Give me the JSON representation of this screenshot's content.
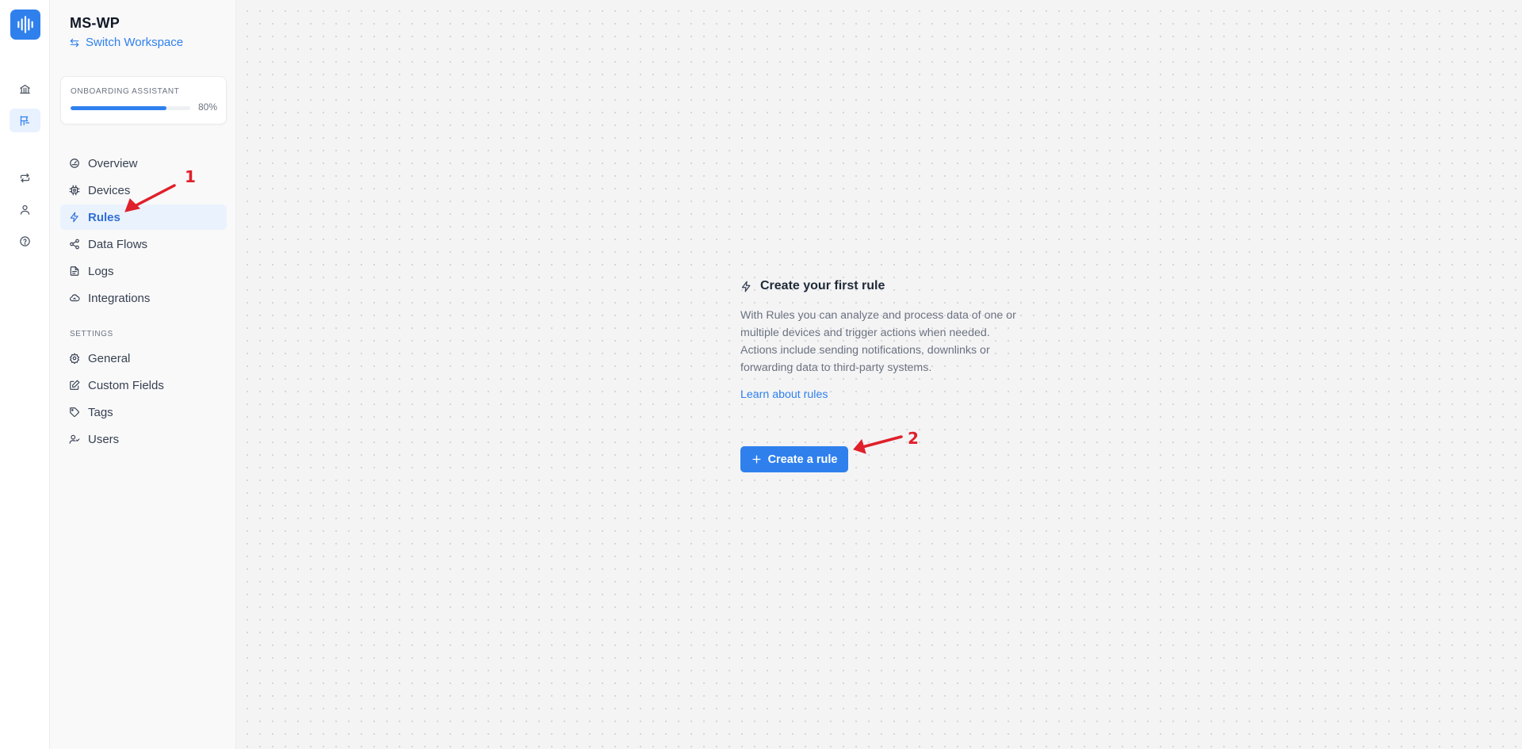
{
  "workspace": {
    "name": "MS-WP",
    "switch_label": "Switch Workspace"
  },
  "rail": {
    "items": [
      {
        "name": "bank-icon",
        "active": false
      },
      {
        "name": "flag-icon",
        "active": true
      },
      {
        "name": "repeat-icon",
        "active": false
      },
      {
        "name": "user-icon",
        "active": false
      },
      {
        "name": "help-icon",
        "active": false
      }
    ]
  },
  "onboarding": {
    "label": "ONBOARDING ASSISTANT",
    "progress": 0.8,
    "progress_label": "80%"
  },
  "nav": {
    "items": [
      {
        "label": "Overview",
        "icon": "gauge-icon",
        "active": false
      },
      {
        "label": "Devices",
        "icon": "chip-icon",
        "active": false
      },
      {
        "label": "Rules",
        "icon": "bolt-icon",
        "active": true
      },
      {
        "label": "Data Flows",
        "icon": "share-icon",
        "active": false
      },
      {
        "label": "Logs",
        "icon": "log-icon",
        "active": false
      },
      {
        "label": "Integrations",
        "icon": "cloud-icon",
        "active": false
      }
    ]
  },
  "settings": {
    "label": "SETTINGS",
    "items": [
      {
        "label": "General",
        "icon": "gear-icon"
      },
      {
        "label": "Custom Fields",
        "icon": "edit-icon"
      },
      {
        "label": "Tags",
        "icon": "tag-icon"
      },
      {
        "label": "Users",
        "icon": "users-icon"
      }
    ]
  },
  "empty_state": {
    "title": "Create your first rule",
    "description": "With Rules you can analyze and process data of one or multiple devices and trigger actions when needed. Actions include sending notifications, downlinks or forwarding data to third-party systems.",
    "learn_link": "Learn about rules",
    "button_label": "Create a rule"
  },
  "annotations": {
    "first": "1",
    "second": "2"
  },
  "colors": {
    "accent": "#2f80ed",
    "annotation": "#e0202b"
  }
}
